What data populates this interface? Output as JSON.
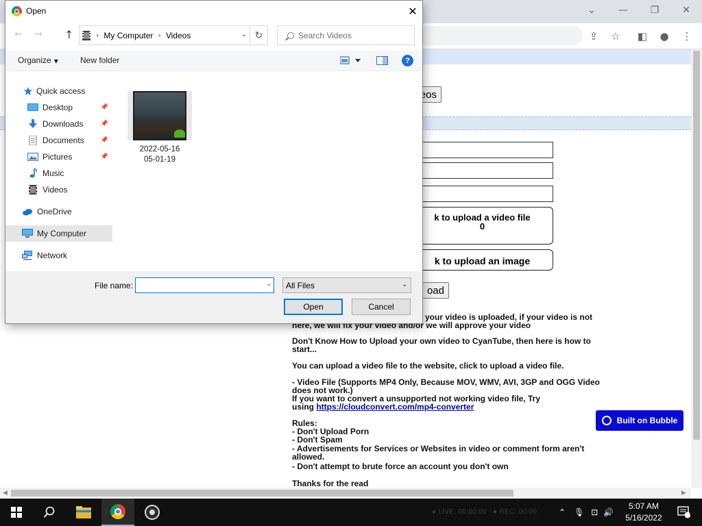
{
  "dialog": {
    "title": "Open",
    "close_glyph": "✕",
    "nav": {
      "back": "←",
      "forward": "→",
      "up": "↑"
    },
    "breadcrumb": [
      "My Computer",
      "Videos"
    ],
    "search_placeholder": "Search Videos",
    "commands": {
      "organize": "Organize",
      "new_folder": "New folder",
      "help": "?"
    },
    "sidebar": [
      {
        "label": "Quick access",
        "icon": "star-icon"
      },
      {
        "label": "Desktop",
        "icon": "desktop-icon",
        "pinned": true
      },
      {
        "label": "Downloads",
        "icon": "download-icon",
        "pinned": true
      },
      {
        "label": "Documents",
        "icon": "document-icon",
        "pinned": true
      },
      {
        "label": "Pictures",
        "icon": "pictures-icon",
        "pinned": true
      },
      {
        "label": "Music",
        "icon": "music-icon"
      },
      {
        "label": "Videos",
        "icon": "videos-icon"
      },
      {
        "label": "OneDrive",
        "icon": "cloud-icon"
      },
      {
        "label": "My Computer",
        "icon": "computer-icon",
        "selected": true
      },
      {
        "label": "Network",
        "icon": "network-icon"
      }
    ],
    "files": [
      {
        "name_line1": "2022-05-16",
        "name_line2": "05-01-19",
        "icon": "video-thumbnail"
      }
    ],
    "file_name_label": "File name:",
    "file_name_value": "",
    "file_type": "All Files",
    "open_button": "Open",
    "cancel_button": "Cancel"
  },
  "page": {
    "videos_button_fragment": "eos",
    "upload_video_line1": "k to upload a video file",
    "upload_video_count": "0",
    "upload_image": "k to upload an image",
    "upload_button_fragment": "oad",
    "paragraphs": [
      "here, we will fix your video and/or we will approve your video",
      "Don't Know How to Upload your own video to CyanTube, then here is how to start...",
      "You can upload a video file to the website, click to upload a video file.",
      "- Video File (Supports MP4 Only, Because MOV, WMV, AVI, 3GP and OGG Video does not work.)",
      "If you want to convert a unsupported not working video file, Try",
      "using",
      "https://cloudconvert.com/mp4-converter",
      "Rules:",
      "- Don't Upload Porn",
      "- Don't Spam",
      "- Advertisements for Services or Websites in video or comment form aren't allowed.",
      "- Don't attempt to brute force an account you don't own",
      "Thanks for the read"
    ],
    "first_line_fragment": "your video is uploaded, if your video is not",
    "badge": "Built on Bubble"
  },
  "taskbar": {
    "obs_live": "LIVE: 00:00:00",
    "obs_rec": "REC: 00:00",
    "time": "5:07 AM",
    "date": "5/16/2022",
    "notification_count": "1"
  },
  "colors": {
    "accent": "#0078d7",
    "bubble": "#0a0ad4",
    "link": "#0000aa"
  }
}
